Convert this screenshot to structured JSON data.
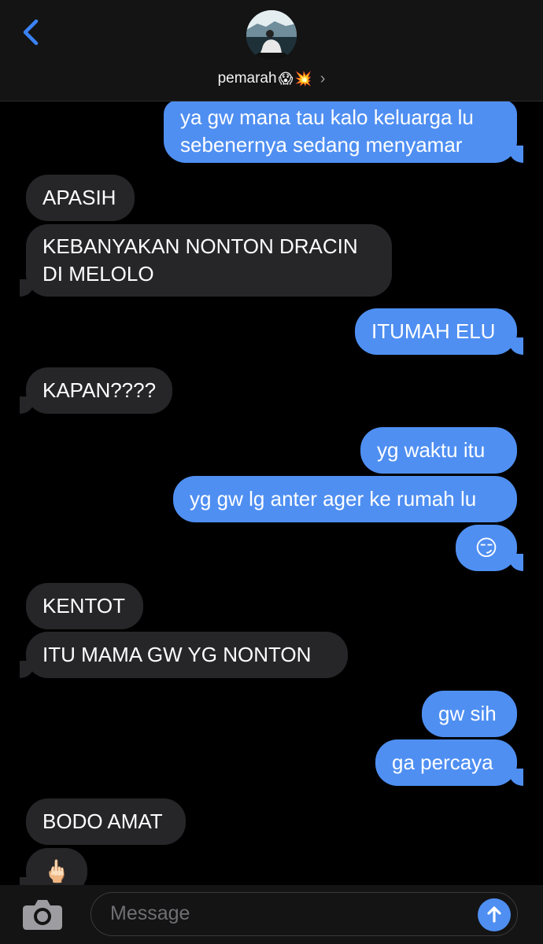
{
  "header": {
    "contact_name": "pemarah",
    "contact_emoji_1": "😱",
    "contact_emoji_2": "💥",
    "chevron": "›",
    "back_icon": "chevron-left-icon",
    "avatar": "contact-photo"
  },
  "messages": [
    {
      "sender": "me",
      "text": "ya gw mana tau kalo keluarga lu\nsebenernya sedang menyamar"
    },
    {
      "sender": "contact",
      "text": "APASIH"
    },
    {
      "sender": "contact",
      "text": "KEBANYAKAN NONTON DRACIN\nDI MELOLO"
    },
    {
      "sender": "me",
      "text": "ITUMAH ELU"
    },
    {
      "sender": "contact",
      "text": "KAPAN????"
    },
    {
      "sender": "me",
      "text": "yg waktu itu"
    },
    {
      "sender": "me",
      "text": "yg gw lg anter ager ke rumah lu"
    },
    {
      "sender": "me",
      "text": "😏"
    },
    {
      "sender": "contact",
      "text": "KENTOT"
    },
    {
      "sender": "contact",
      "text": "ITU MAMA GW YG NONTON"
    },
    {
      "sender": "me",
      "text": "gw sih"
    },
    {
      "sender": "me",
      "text": "ga percaya"
    },
    {
      "sender": "contact",
      "text": "BODO AMAT"
    },
    {
      "sender": "contact",
      "text": "🖕🏻"
    }
  ],
  "composer": {
    "placeholder": "Message",
    "camera_icon": "camera-icon",
    "send_icon": "arrow-up-icon"
  },
  "colors": {
    "sent_bubble": "#4f8ff2",
    "received_bubble": "#262629",
    "background": "#000000",
    "accent": "#3b82f6"
  }
}
